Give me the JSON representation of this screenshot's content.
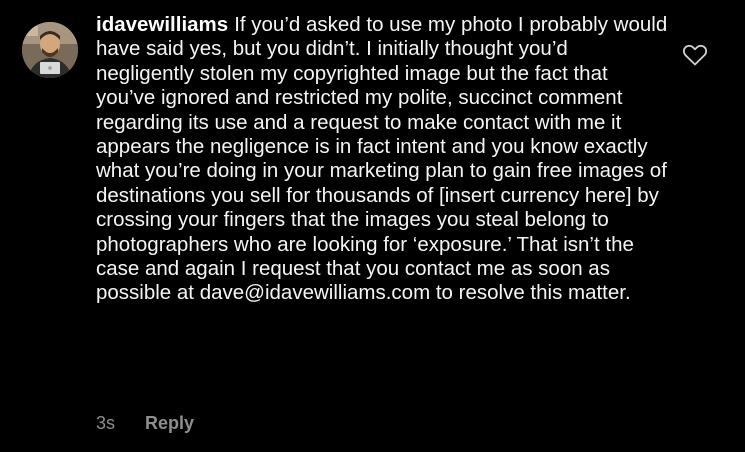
{
  "comment": {
    "username": "idavewilliams",
    "text": "If you’d asked to use my photo I probably would have said yes, but you didn’t. I initially thought you’d negligently stolen my copyrighted image but the fact that you’ve ignored and restricted my polite, succinct comment regarding its use and a request to make contact with me it appears the negligence is in fact intent and you know exactly what you’re doing in your marketing plan to gain free images of destinations you sell for thousands of [insert currency here] by crossing your fingers that the images you steal belong to photographers who are looking for ‘exposure.’ That isn’t the case and again I request that you contact me as soon as possible at dave@idavewilliams.com to resolve this matter.",
    "timestamp": "3s",
    "reply_label": "Reply",
    "like_icon": "heart-outline-icon"
  },
  "colors": {
    "background": "#000000",
    "text": "#f5f5f5",
    "meta": "#8e8e8e"
  }
}
